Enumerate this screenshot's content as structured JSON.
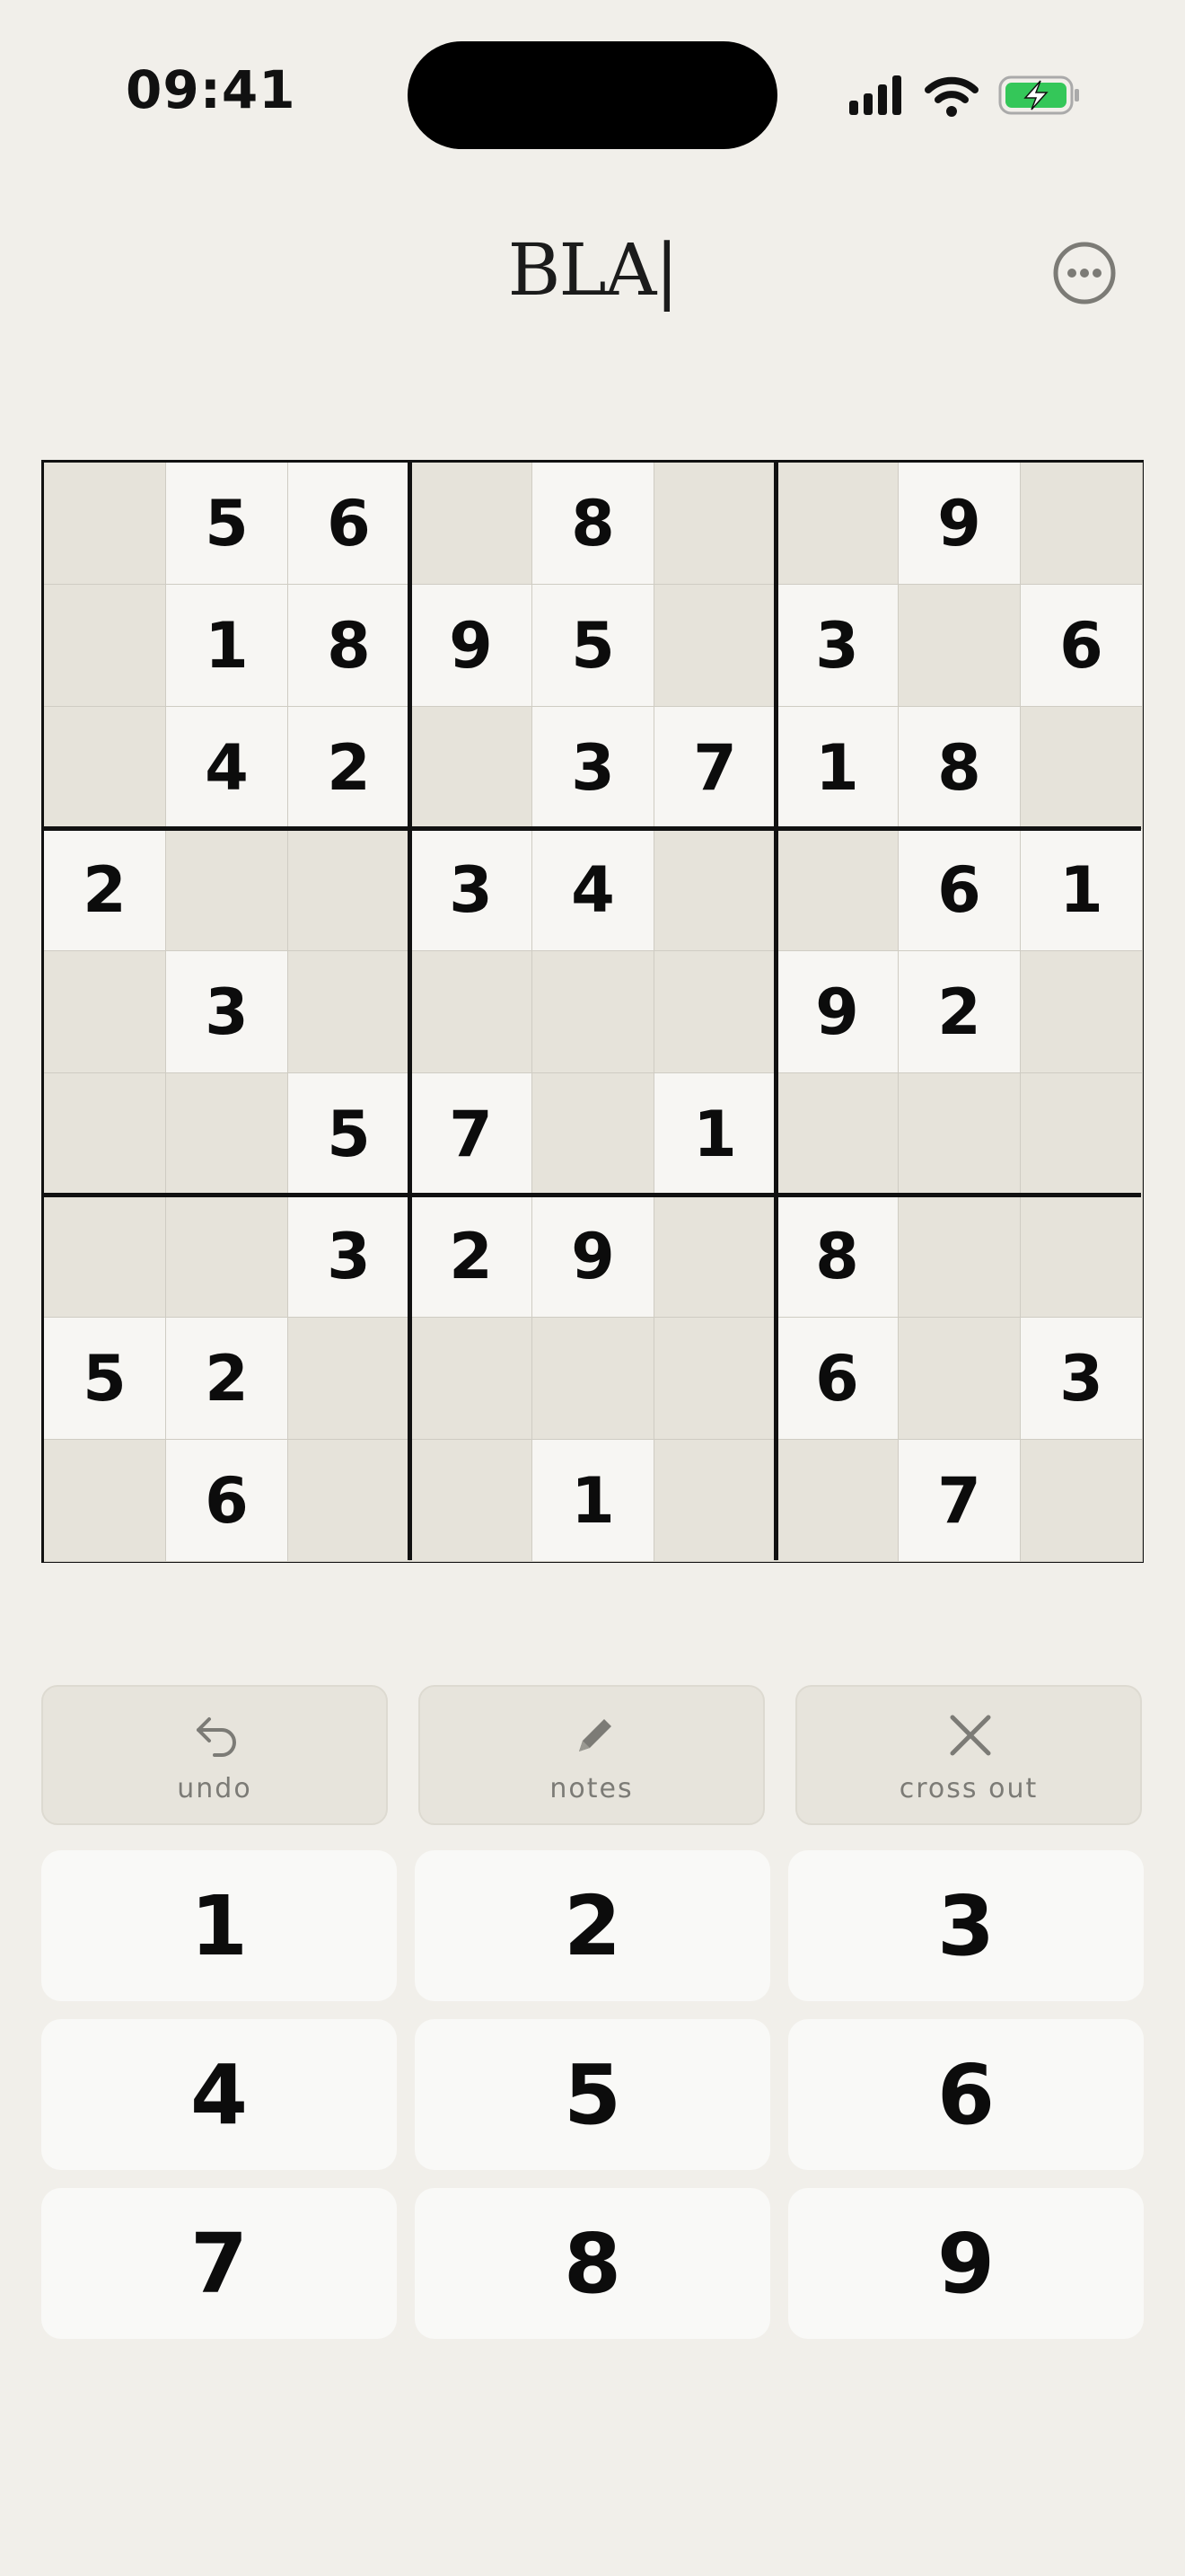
{
  "status_bar": {
    "time": "09:41",
    "battery_color": "#34c759"
  },
  "header": {
    "logo_text": "BLA|",
    "menu_icon": "more-horizontal-circle-icon"
  },
  "board": {
    "grid": [
      [
        "",
        "5",
        "6",
        "",
        "8",
        "",
        "",
        "9",
        ""
      ],
      [
        "",
        "1",
        "8",
        "9",
        "5",
        "",
        "3",
        "",
        "6"
      ],
      [
        "",
        "4",
        "2",
        "",
        "3",
        "7",
        "1",
        "8",
        ""
      ],
      [
        "2",
        "",
        "",
        "3",
        "4",
        "",
        "",
        "6",
        "1"
      ],
      [
        "",
        "3",
        "",
        "",
        "",
        "",
        "9",
        "2",
        ""
      ],
      [
        "",
        "",
        "5",
        "7",
        "",
        "1",
        "",
        "",
        ""
      ],
      [
        "",
        "",
        "3",
        "2",
        "9",
        "",
        "8",
        "",
        ""
      ],
      [
        "5",
        "2",
        "",
        "",
        "",
        "",
        "6",
        "",
        "3"
      ],
      [
        "",
        "6",
        "",
        "",
        "1",
        "",
        "",
        "7",
        ""
      ]
    ]
  },
  "tools": [
    {
      "label": "undo",
      "icon": "undo-icon"
    },
    {
      "label": "notes",
      "icon": "pencil-icon"
    },
    {
      "label": "cross out",
      "icon": "x-icon"
    }
  ],
  "numpad": [
    "1",
    "2",
    "3",
    "4",
    "5",
    "6",
    "7",
    "8",
    "9"
  ],
  "colors": {
    "background": "#f1efea",
    "given_cell": "#f7f6f3",
    "empty_cell": "#e6e3da",
    "tool_button": "#e7e4dc",
    "key": "#f9f9f7"
  }
}
